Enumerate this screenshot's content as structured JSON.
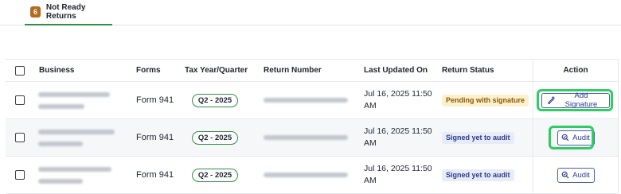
{
  "tabs": [
    {
      "count": "6",
      "label": "Not Ready Returns"
    }
  ],
  "table": {
    "headers": {
      "business": "Business",
      "forms": "Forms",
      "tax_year_quarter": "Tax Year/Quarter",
      "return_number": "Return Number",
      "last_updated": "Last Updated On",
      "return_status": "Return Status",
      "action": "Action"
    },
    "rows": [
      {
        "form": "Form 941",
        "quarter": "Q2 - 2025",
        "updated_line1": "Jul 16, 2025 11:50",
        "updated_line2": "AM",
        "status": "Pending with signature",
        "action_label": "Add Signature",
        "action_icon": "signature-pen-icon"
      },
      {
        "form": "Form 941",
        "quarter": "Q2 - 2025",
        "updated_line1": "Jul 16, 2025 11:50",
        "updated_line2": "AM",
        "status": "Signed yet to audit",
        "action_label": "Audit",
        "action_icon": "magnifier-icon"
      },
      {
        "form": "Form 941",
        "quarter": "Q2 - 2025",
        "updated_line1": "Jul 16, 2025 11:50",
        "updated_line2": "AM",
        "status": "Signed yet to audit",
        "action_label": "Audit",
        "action_icon": "magnifier-icon"
      }
    ]
  },
  "colors": {
    "accent_green": "#2f8f46",
    "highlight_green": "#2ecc63",
    "tab_badge": "#b26a1e",
    "pending_bg": "#fdf0cf",
    "pending_text": "#8a5a00",
    "audit_bg": "#e8ecf8",
    "audit_text": "#2b3a8f",
    "button_border": "#4a5fa8"
  }
}
